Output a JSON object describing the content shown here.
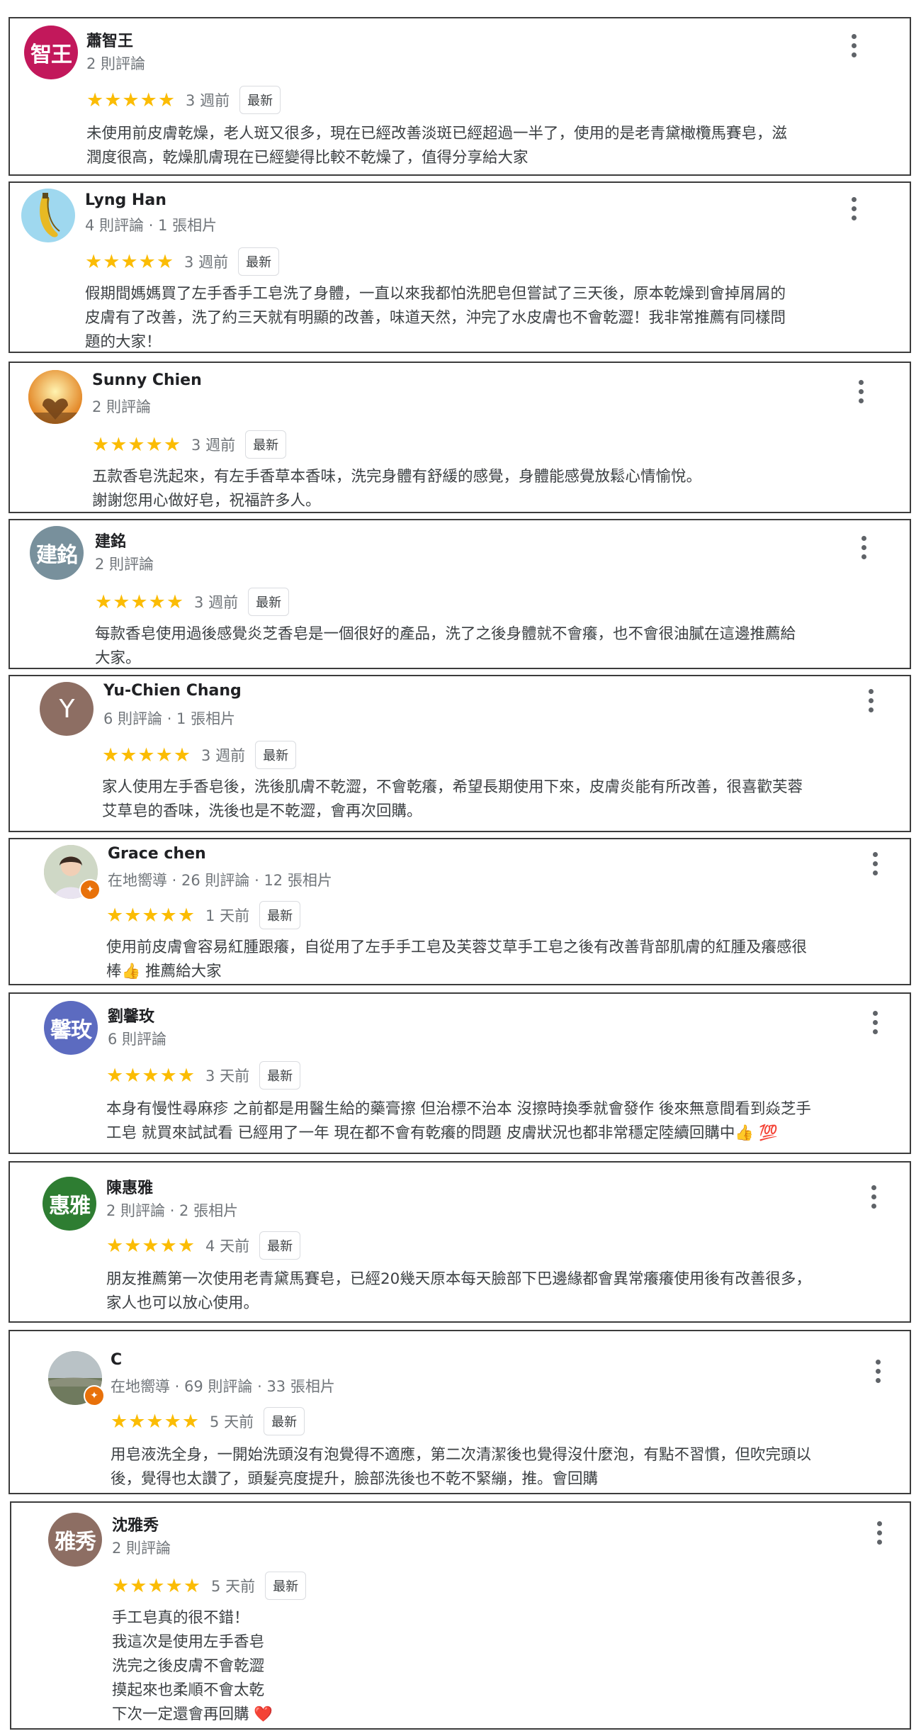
{
  "reviews": [
    {
      "avatar_text": "智王",
      "avatar_color": "#c2185b",
      "name": "蕭智王",
      "meta": "2 則評論",
      "stars": "★★★★★",
      "rating": 5,
      "when": "3 週前",
      "badge": "最新",
      "text": "未使用前皮膚乾燥，老人斑又很多，現在已經改善淡斑已經超過一半了，使用的是老青黛橄欖馬賽皂，滋\n潤度很高，乾燥肌膚現在已經變得比較不乾燥了，值得分享給大家"
    },
    {
      "avatar_icon": "banana-icon",
      "avatar_color": "#9fd8ef",
      "name": "Lyng Han",
      "meta": "4 則評論 · 1 張相片",
      "stars": "★★★★★",
      "rating": 5,
      "when": "3 週前",
      "badge": "最新",
      "text": "假期間媽媽買了左手香手工皂洗了身體，一直以來我都怕洗肥皂但嘗試了三天後，原本乾燥到會掉屑屑的\n皮膚有了改善，洗了約三天就有明顯的改善，味道天然，沖完了水皮膚也不會乾澀！我非常推薦有同樣問\n題的大家！"
    },
    {
      "avatar_icon": "sunset-heart-icon",
      "avatar_color": "#f2a23a",
      "name": "Sunny Chien",
      "meta": "2 則評論",
      "stars": "★★★★★",
      "rating": 5,
      "when": "3 週前",
      "badge": "最新",
      "text": "五款香皂洗起來，有左手香草本香味，洗完身體有舒緩的感覺，身體能感覺放鬆心情愉悅。\n謝謝您用心做好皂，祝福許多人。"
    },
    {
      "avatar_text": "建銘",
      "avatar_color": "#78909c",
      "name": "建銘",
      "meta": "2 則評論",
      "stars": "★★★★★",
      "rating": 5,
      "when": "3 週前",
      "badge": "最新",
      "text": "每款香皂使用過後感覺炎芝香皂是一個很好的產品，洗了之後身體就不會癢，也不會很油膩在這邊推薦給\n大家。"
    },
    {
      "avatar_text": "Y",
      "avatar_color": "#8d6e63",
      "name": "Yu-Chien Chang",
      "meta": "6 則評論 · 1 張相片",
      "stars": "★★★★★",
      "rating": 5,
      "when": "3 週前",
      "badge": "最新",
      "text": "家人使用左手香皂後，洗後肌膚不乾澀，不會乾癢，希望長期使用下來，皮膚炎能有所改善，很喜歡芙蓉\n艾草皂的香味，洗後也是不乾澀，會再次回購。"
    },
    {
      "avatar_icon": "portrait-photo-icon",
      "avatar_color": "#d9c2b0",
      "local_guide": true,
      "name": "Grace chen",
      "meta": "在地嚮導 · 26 則評論 · 12 張相片",
      "stars": "★★★★★",
      "rating": 5,
      "when": "1 天前",
      "badge": "最新",
      "text": "使用前皮膚會容易紅腫跟癢，自從用了左手手工皂及芙蓉艾草手工皂之後有改善背部肌膚的紅腫及癢感很\n棒👍 推薦給大家"
    },
    {
      "avatar_text": "馨玫",
      "avatar_color": "#5c6bc0",
      "name": "劉馨玫",
      "meta": "6 則評論",
      "stars": "★★★★★",
      "rating": 5,
      "when": "3 天前",
      "badge": "最新",
      "text": "本身有慢性尋麻疹 之前都是用醫生給的藥膏擦 但治標不治本 沒擦時換季就會發作 後來無意間看到焱芝手\n工皂 就買來試試看 已經用了一年 現在都不會有乾癢的問題 皮膚狀況也都非常穩定陸續回購中👍 💯"
    },
    {
      "avatar_text": "惠雅",
      "avatar_color": "#2e7d32",
      "name": "陳惠雅",
      "meta": "2 則評論 · 2 張相片",
      "stars": "★★★★★",
      "rating": 5,
      "when": "4 天前",
      "badge": "最新",
      "text": "朋友推薦第一次使用老青黛馬賽皂，已經20幾天原本每天臉部下巴邊緣都會異常癢癢使用後有改善很多，\n家人也可以放心使用。"
    },
    {
      "avatar_icon": "landscape-photo-icon",
      "avatar_color": "#a9b3a6",
      "local_guide": true,
      "name": "C",
      "meta": "在地嚮導 · 69 則評論 · 33 張相片",
      "stars": "★★★★★",
      "rating": 5,
      "when": "5 天前",
      "badge": "最新",
      "text": "用皂液洗全身，一開始洗頭沒有泡覺得不適應，第二次清潔後也覺得沒什麼泡，有點不習慣，但吹完頭以\n後，覺得也太讚了，頭髮亮度提升，臉部洗後也不乾不緊繃，推。會回購"
    },
    {
      "avatar_text": "雅秀",
      "avatar_color": "#8d6e63",
      "name": "沈雅秀",
      "meta": "2 則評論",
      "stars": "★★★★★",
      "rating": 5,
      "when": "5 天前",
      "badge": "最新",
      "text": "手工皂真的很不錯！\n我這次是使用左手香皂\n洗完之後皮膚不會乾澀\n摸起來也柔順不會太乾\n下次一定還會再回購 ❤️"
    }
  ]
}
